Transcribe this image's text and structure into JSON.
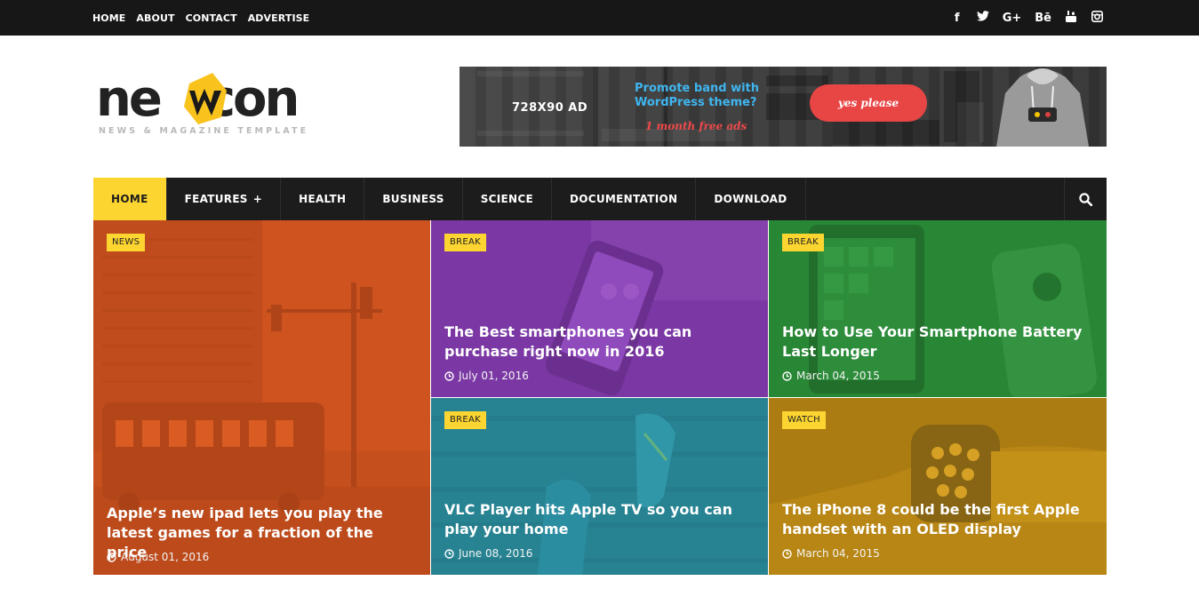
{
  "topbar": {
    "links": [
      "HOME",
      "ABOUT",
      "CONTACT",
      "ADVERTISE"
    ],
    "social": [
      {
        "icon": "facebook-icon",
        "glyph": "f"
      },
      {
        "icon": "twitter-icon",
        "glyph": "t"
      },
      {
        "icon": "google-plus-icon",
        "glyph": "G+"
      },
      {
        "icon": "behance-icon",
        "glyph": "Bē"
      },
      {
        "icon": "youtube-icon",
        "glyph": "▶"
      },
      {
        "icon": "instagram-icon",
        "glyph": "◎"
      }
    ]
  },
  "logo": {
    "part1": "ne",
    "part2": "con",
    "tagline": "NEWS & MAGAZINE TEMPLATE",
    "accent": "#f9c31d"
  },
  "banner": {
    "size": "728X90 AD",
    "promo": "Promote band with WordPress theme?",
    "free": "1 month free ads",
    "cta": "yes please"
  },
  "nav": {
    "items": [
      {
        "label": "HOME",
        "active": true
      },
      {
        "label": "FEATURES",
        "plus": "+"
      },
      {
        "label": "HEALTH"
      },
      {
        "label": "BUSINESS"
      },
      {
        "label": "SCIENCE"
      },
      {
        "label": "DOCUMENTATION"
      },
      {
        "label": "DOWNLOAD"
      }
    ],
    "active_color": "#fcd531"
  },
  "posts": [
    {
      "category": "NEWS",
      "title": "Apple’s new ipad lets you play the latest games for a fraction of the price",
      "date": "August 01, 2016",
      "tint": "#e2581e"
    },
    {
      "category": "BREAK",
      "title": "The Best smartphones you can purchase right now in 2016",
      "date": "July 01, 2016",
      "tint": "#8a3fb8"
    },
    {
      "category": "BREAK",
      "title": "How to Use Your Smartphone Battery Last Longer",
      "date": "March 04, 2015",
      "tint": "#2e9a3c"
    },
    {
      "category": "BREAK",
      "title": "VLC Player hits Apple TV so you can play your home",
      "date": "June 08, 2016",
      "tint": "#2a8fa0"
    },
    {
      "category": "WATCH",
      "title": "The iPhone 8 could be the first Apple handset with an OLED display",
      "date": "March 04, 2015",
      "tint": "#c99516"
    }
  ]
}
